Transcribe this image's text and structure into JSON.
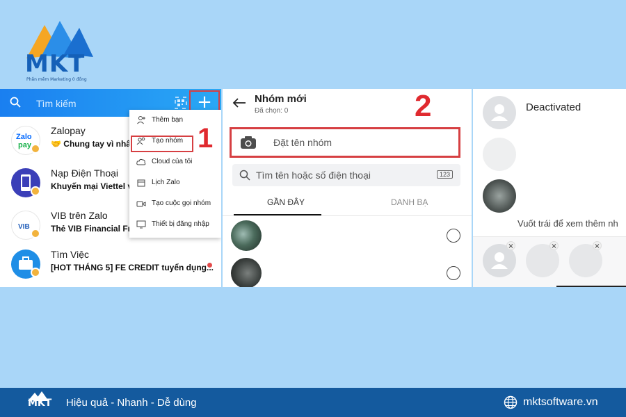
{
  "logo": {
    "text": "MKT",
    "subtitle": "Phần mềm Marketing 0 đồng"
  },
  "panel1": {
    "search_placeholder": "Tìm kiếm",
    "chats": [
      {
        "name": "Zalopay",
        "message": "🤝 Chung tay vì nhân c",
        "avatar_text": "Zalo\npay"
      },
      {
        "name": "Nạp Điện Thoại",
        "message": "Khuyến mại Viettel và V"
      },
      {
        "name": "VIB trên Zalo",
        "message": "Thẻ VIB Financial Free",
        "avatar_text": "VIB"
      },
      {
        "name": "Tìm Việc",
        "message": "[HOT THÁNG 5] FE CREDIT tuyển dụng..."
      }
    ],
    "menu": [
      {
        "label": "Thêm bạn",
        "icon": "add-friend-icon"
      },
      {
        "label": "Tạo nhóm",
        "icon": "group-icon"
      },
      {
        "label": "Cloud của tôi",
        "icon": "cloud-icon"
      },
      {
        "label": "Lịch Zalo",
        "icon": "calendar-icon"
      },
      {
        "label": "Tạo cuộc gọi nhóm",
        "icon": "video-call-icon"
      },
      {
        "label": "Thiết bị đăng nhập",
        "icon": "monitor-icon"
      }
    ],
    "step": "1"
  },
  "panel2": {
    "title": "Nhóm mới",
    "subtitle": "Đã chọn: 0",
    "step": "2",
    "group_name_placeholder": "Đặt tên nhóm",
    "search_placeholder": "Tìm tên hoặc số điện thoại",
    "keyboard_toggle": "123",
    "tabs": [
      "GẦN ĐÂY",
      "DANH BẠ"
    ]
  },
  "panel3": {
    "deactivated": "Deactivated",
    "hint": "Vuốt trái để xem thêm nh"
  },
  "footer": {
    "logo_text": "MKT",
    "tagline": "Hiệu quả - Nhanh - Dễ dùng",
    "website": "mktsoftware.vn"
  },
  "colors": {
    "accent": "#1a7ff0",
    "highlight": "#d63f42",
    "footer": "#145a9e",
    "background": "#a9d6f8"
  }
}
